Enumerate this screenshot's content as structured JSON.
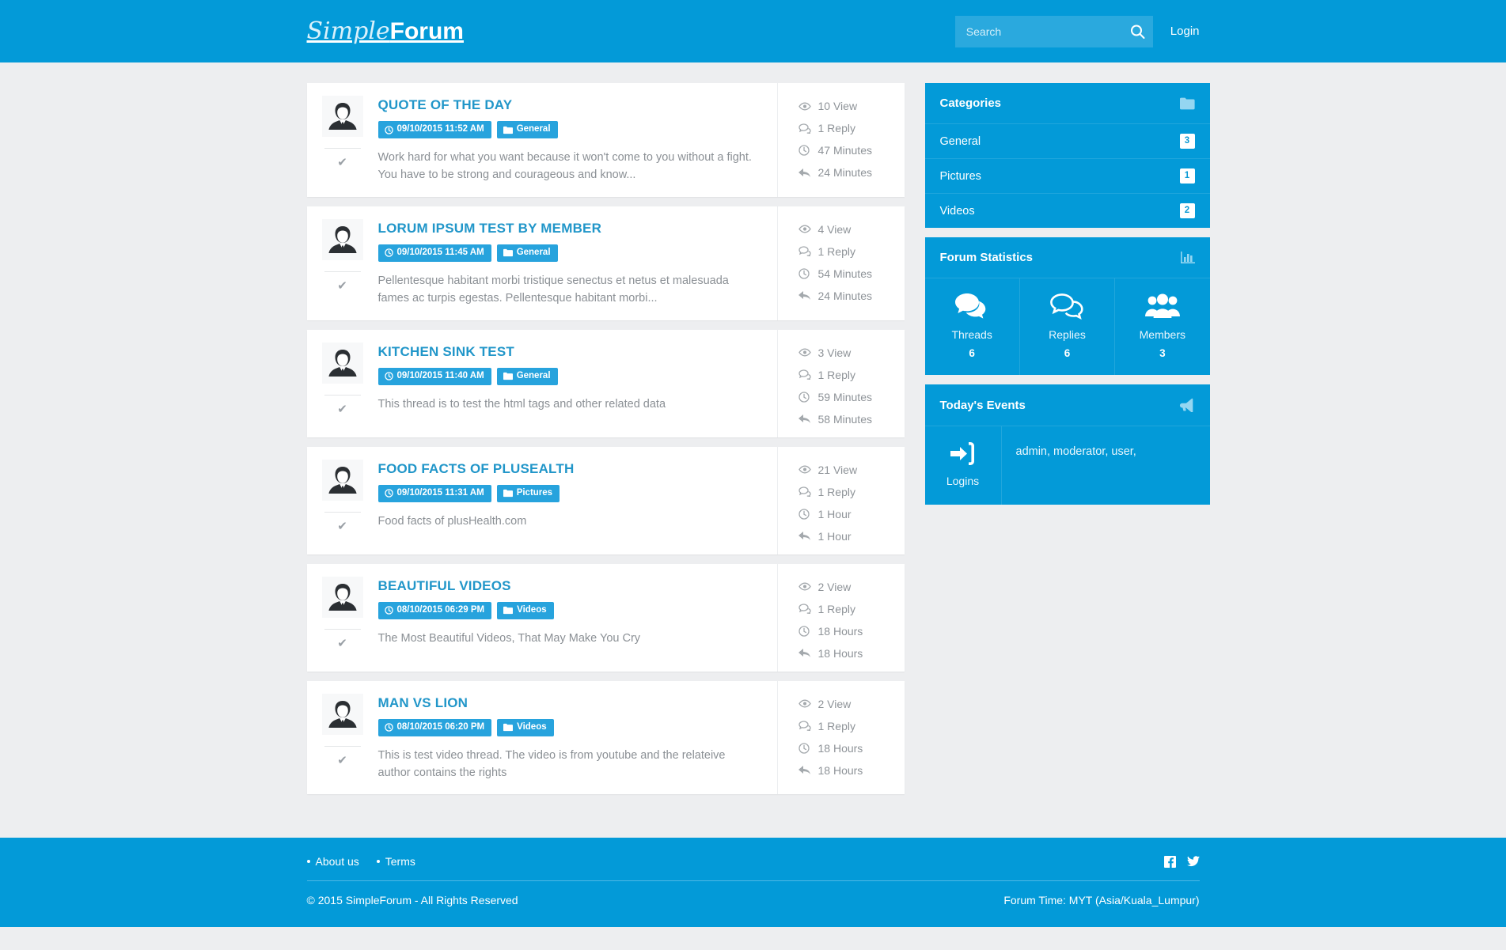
{
  "header": {
    "logo_light": "Simple",
    "logo_bold": "Forum",
    "search_placeholder": "Search",
    "search_value": "",
    "search_icon": "search-icon",
    "login_label": "Login",
    "brand_color": "#039ad8"
  },
  "threads": [
    {
      "title": "QUOTE OF THE DAY",
      "date": "09/10/2015 11:52 AM",
      "category": "General",
      "excerpt": "Work hard for what you want because it won't come to you without a fight. You have to be strong and courageous and know...",
      "views": "10 View",
      "replies": "1 Reply",
      "created": "47 Minutes",
      "last_reply": "24 Minutes"
    },
    {
      "title": "LORUM IPSUM TEST BY MEMBER",
      "date": "09/10/2015 11:45 AM",
      "category": "General",
      "excerpt": "Pellentesque habitant morbi tristique senectus et netus et malesuada fames ac turpis egestas. Pellentesque habitant morbi...",
      "views": "4 View",
      "replies": "1 Reply",
      "created": "54 Minutes",
      "last_reply": "24 Minutes"
    },
    {
      "title": "KITCHEN SINK TEST",
      "date": "09/10/2015 11:40 AM",
      "category": "General",
      "excerpt": "This thread is to test the html tags and other related data",
      "views": "3 View",
      "replies": "1 Reply",
      "created": "59 Minutes",
      "last_reply": "58 Minutes"
    },
    {
      "title": "FOOD FACTS OF PLUSEALTH",
      "date": "09/10/2015 11:31 AM",
      "category": "Pictures",
      "excerpt": "Food facts of plusHealth.com",
      "views": "21 View",
      "replies": "1 Reply",
      "created": "1 Hour",
      "last_reply": "1 Hour"
    },
    {
      "title": "BEAUTIFUL VIDEOS",
      "date": "08/10/2015 06:29 PM",
      "category": "Videos",
      "excerpt": "The Most Beautiful Videos, That May Make You Cry",
      "views": "2 View",
      "replies": "1 Reply",
      "created": "18 Hours",
      "last_reply": "18 Hours"
    },
    {
      "title": "MAN VS LION",
      "date": "08/10/2015 06:20 PM",
      "category": "Videos",
      "excerpt": "This is test video thread. The video is from youtube and the relateive author contains the rights",
      "views": "2 View",
      "replies": "1 Reply",
      "created": "18 Hours",
      "last_reply": "18 Hours"
    }
  ],
  "sidebar": {
    "categories": {
      "title": "Categories",
      "icon": "folder-icon",
      "items": [
        {
          "label": "General",
          "count": "3"
        },
        {
          "label": "Pictures",
          "count": "1"
        },
        {
          "label": "Videos",
          "count": "2"
        }
      ]
    },
    "statistics": {
      "title": "Forum Statistics",
      "icon": "bar-chart-icon",
      "cells": [
        {
          "label": "Threads",
          "value": "6",
          "icon": "comments-icon"
        },
        {
          "label": "Replies",
          "value": "6",
          "icon": "comment-icon"
        },
        {
          "label": "Members",
          "value": "3",
          "icon": "group-icon"
        }
      ]
    },
    "events": {
      "title": "Today's Events",
      "icon": "megaphone-icon",
      "logins_label": "Logins",
      "logins_icon": "sign-in-icon",
      "logins_users": "admin, moderator, user,"
    }
  },
  "footer": {
    "links": [
      {
        "label": "About us"
      },
      {
        "label": "Terms"
      }
    ],
    "social": [
      {
        "name": "facebook-icon"
      },
      {
        "name": "twitter-icon"
      }
    ],
    "copyright": "© 2015 SimpleForum - All Rights Reserved",
    "forum_time": "Forum Time: MYT (Asia/Kuala_Lumpur)"
  }
}
